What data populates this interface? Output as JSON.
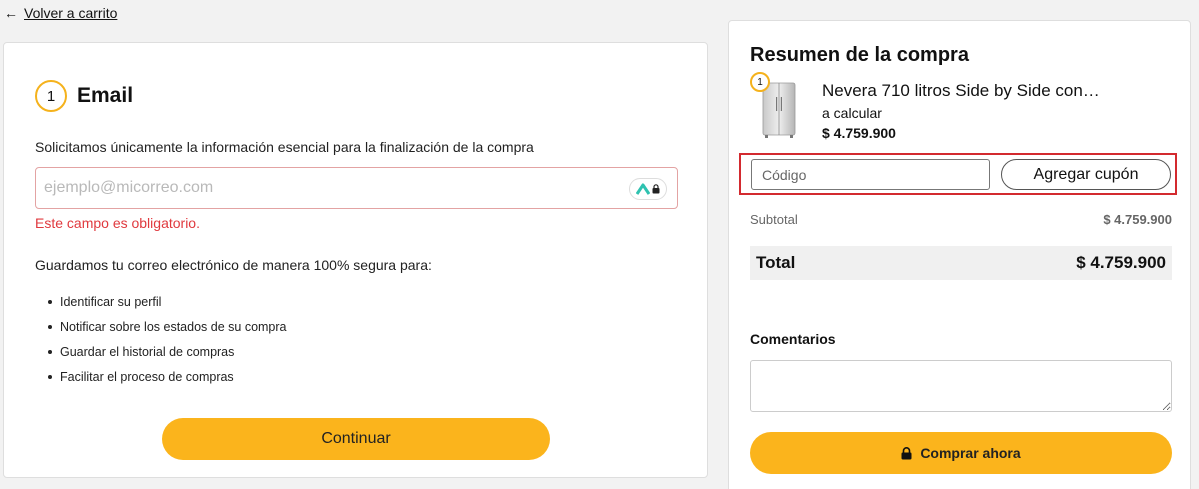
{
  "nav": {
    "back_label": "Volver a carrito",
    "back_icon": "arrow-left-icon"
  },
  "email_step": {
    "step_number": "1",
    "title": "Email",
    "info": "Solicitamos únicamente la información esencial para la finalización de la compra",
    "email_placeholder": "ejemplo@micorreo.com",
    "email_value": "",
    "error": "Este campo es obligatorio.",
    "secure_info": "Guardamos tu correo electrónico de manera 100% segura para:",
    "benefits": [
      "Identificar su perfil",
      "Notificar sobre los estados de su compra",
      "Guardar el historial de compras",
      "Facilitar el proceso de compras"
    ],
    "continue_label": "Continuar"
  },
  "summary": {
    "title": "Resumen de la compra",
    "item": {
      "quantity": "1",
      "name": "Nevera 710 litros Side by Side con…",
      "shipping": "a calcular",
      "price": "$ 4.759.900"
    },
    "coupon": {
      "placeholder": "Código",
      "button_label": "Agregar cupón"
    },
    "subtotal_label": "Subtotal",
    "subtotal_value": "$ 4.759.900",
    "total_label": "Total",
    "total_value": "$ 4.759.900",
    "comments_label": "Comentarios",
    "buy_label": "Comprar ahora",
    "buy_icon": "lock-icon"
  },
  "colors": {
    "accent": "#fbb41c",
    "error": "#e0393e",
    "highlight_border": "#d32a2f"
  }
}
